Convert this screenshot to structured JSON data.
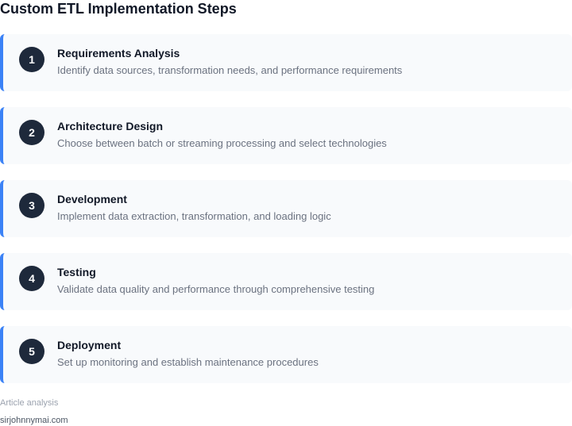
{
  "title": "Custom ETL Implementation Steps",
  "steps": [
    {
      "number": "1",
      "title": "Requirements Analysis",
      "description": "Identify data sources, transformation needs, and performance requirements"
    },
    {
      "number": "2",
      "title": "Architecture Design",
      "description": "Choose between batch or streaming processing and select technologies"
    },
    {
      "number": "3",
      "title": "Development",
      "description": "Implement data extraction, transformation, and loading logic"
    },
    {
      "number": "4",
      "title": "Testing",
      "description": "Validate data quality and performance through comprehensive testing"
    },
    {
      "number": "5",
      "title": "Deployment",
      "description": "Set up monitoring and establish maintenance procedures"
    }
  ],
  "footer": {
    "label": "Article analysis",
    "site": "sirjohnnymai.com"
  },
  "colors": {
    "accent": "#3b82f6",
    "badge": "#1e293b",
    "card_bg": "#f8fafc"
  }
}
